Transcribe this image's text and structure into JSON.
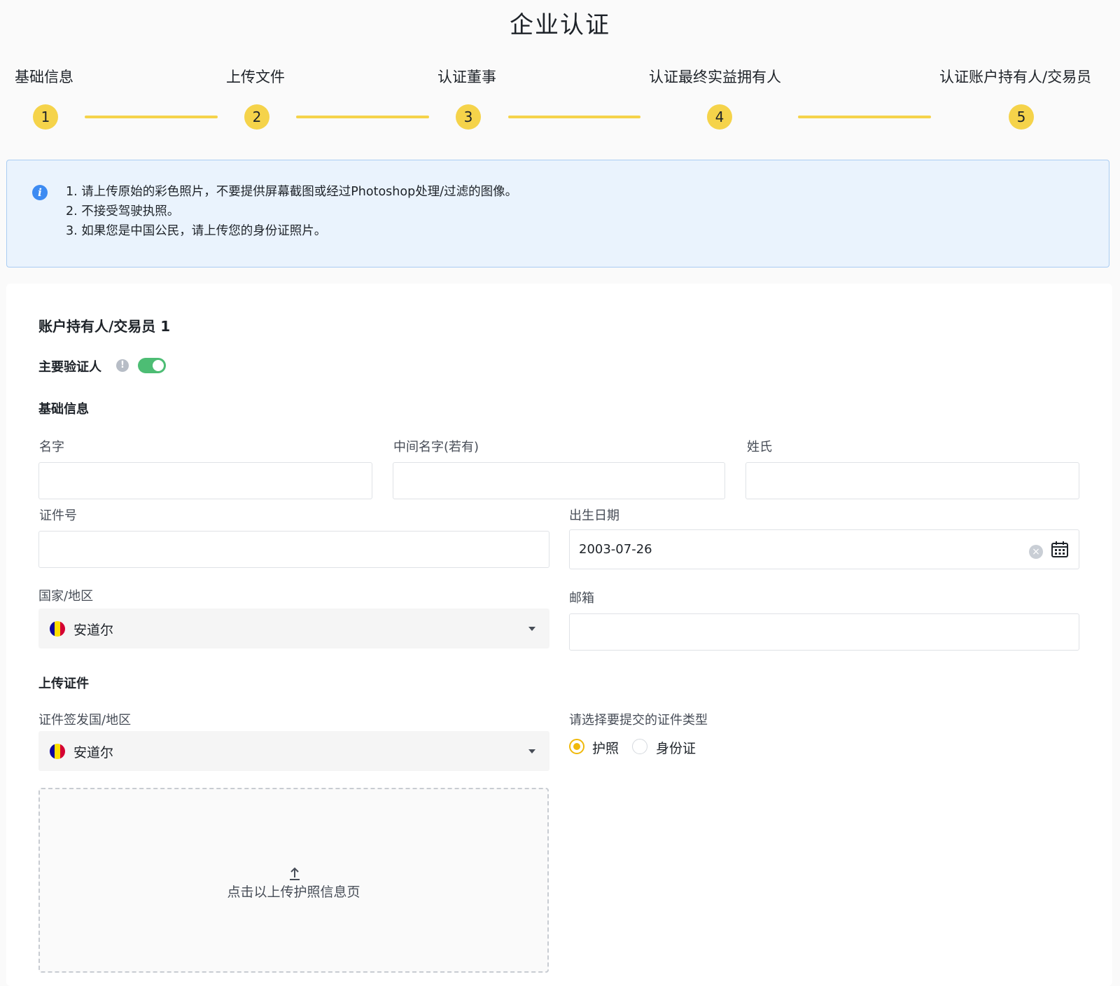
{
  "page": {
    "title": "企业认证"
  },
  "stepper": {
    "steps": [
      {
        "label": "基础信息",
        "number": "1"
      },
      {
        "label": "上传文件",
        "number": "2"
      },
      {
        "label": "认证董事",
        "number": "3"
      },
      {
        "label": "认证最终实益拥有人",
        "number": "4"
      },
      {
        "label": "认证账户持有人/交易员",
        "number": "5"
      }
    ],
    "color": "#f5d34a"
  },
  "notice": {
    "icon": "info-icon",
    "lines": [
      "1. 请上传原始的彩色照片，不要提供屏幕截图或经过Photoshop处理/过滤的图像。",
      "2. 不接受驾驶执照。",
      "3. 如果您是中国公民，请上传您的身份证照片。"
    ]
  },
  "form": {
    "section_title": "账户持有人/交易员 1",
    "primary_verifier": {
      "label": "主要验证人",
      "toggle_on": true,
      "toggle_color": "#4dbd74"
    },
    "basic_info": {
      "title": "基础信息",
      "first_name": {
        "label": "名字",
        "value": ""
      },
      "middle_name": {
        "label": "中间名字(若有)",
        "value": ""
      },
      "last_name": {
        "label": "姓氏",
        "value": ""
      },
      "id_number": {
        "label": "证件号",
        "value": ""
      },
      "birth_date": {
        "label": "出生日期",
        "value": "2003-07-26"
      },
      "country": {
        "label": "国家/地区",
        "value": "安道尔"
      },
      "email": {
        "label": "邮箱",
        "value": ""
      }
    },
    "upload": {
      "title": "上传证件",
      "issuing_country": {
        "label": "证件签发国/地区",
        "value": "安道尔"
      },
      "doc_type": {
        "label": "请选择要提交的证件类型",
        "options": [
          {
            "label": "护照",
            "selected": true
          },
          {
            "label": "身份证",
            "selected": false
          }
        ],
        "accent": "#f0b90b"
      },
      "dropzone_text": "点击以上传护照信息页"
    }
  }
}
